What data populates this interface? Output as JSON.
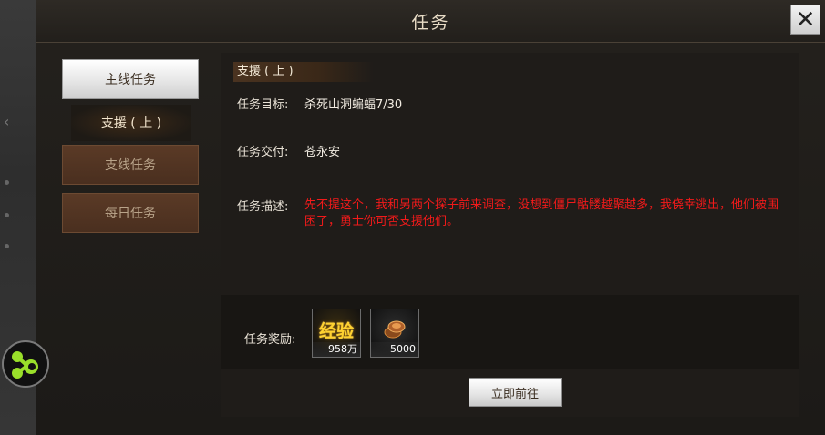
{
  "window": {
    "title": "任务",
    "close_label": "✕"
  },
  "tabs": {
    "main": "主线任务",
    "main_sub": "支援 ( 上 )",
    "branch": "支线任务",
    "daily": "每日任务"
  },
  "task": {
    "name": "支援 ( 上 )",
    "goal_label": "任务目标:",
    "goal_value": "杀死山洞蝙蝠7/30",
    "deliver_label": "任务交付:",
    "deliver_value": "苍永安",
    "desc_label": "任务描述:",
    "desc_value": "先不提这个，我和另两个探子前来调查，没想到僵尸骷髅越聚越多，我侥幸逃出，他们被围困了，勇士你可否支援他们。"
  },
  "rewards": {
    "label": "任务奖励:",
    "items": [
      {
        "icon": "exp-icon",
        "icon_text": "经验",
        "count": "958万"
      },
      {
        "icon": "gold-coin-icon",
        "count": "5000"
      }
    ]
  },
  "go_button": "立即前往",
  "colors": {
    "desc_red": "#f21a1a",
    "exp_gold": "#ffd230",
    "float_green": "#9ae02a"
  }
}
